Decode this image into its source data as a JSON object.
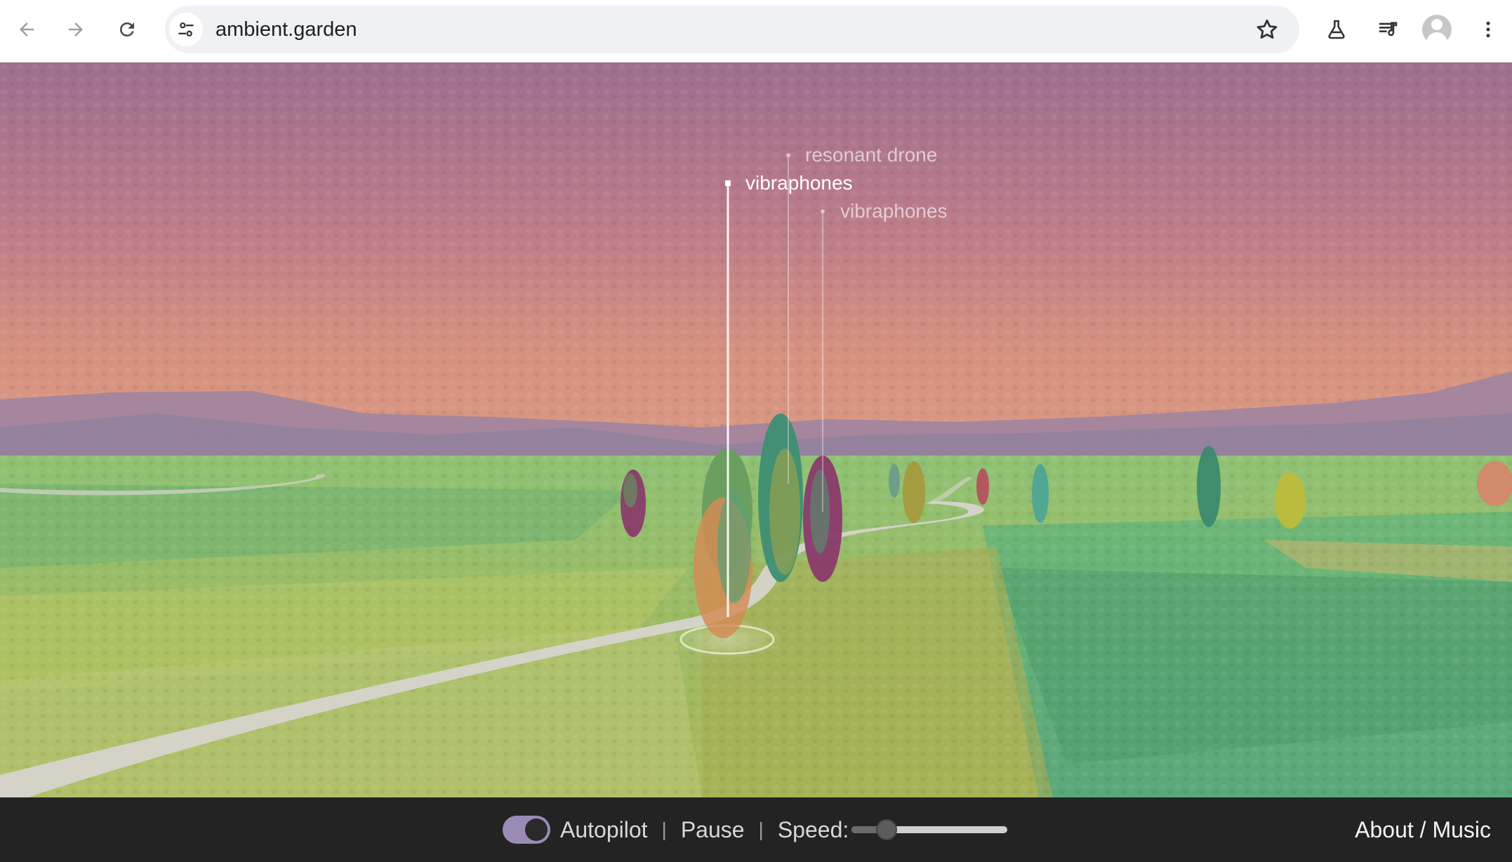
{
  "browser": {
    "url": "ambient.garden",
    "back_icon": "arrow-left-icon",
    "forward_icon": "arrow-right-icon",
    "reload_icon": "reload-icon",
    "site_info_icon": "tune-icon",
    "bookmark_icon": "star-icon",
    "labs_icon": "flask-icon",
    "media_icon": "playlist-music-icon",
    "profile_icon": "avatar-icon",
    "menu_icon": "more-vertical-icon"
  },
  "scene": {
    "labels": [
      {
        "text": "resonant drone",
        "state": "faded"
      },
      {
        "text": "vibraphones",
        "state": "active"
      },
      {
        "text": "vibraphones",
        "state": "faded"
      }
    ],
    "colors": {
      "sky_top": "#a0728e",
      "sky_horizon": "#d99a82",
      "hills": "#9a80a0",
      "grass": "#7fb86a",
      "path": "#d8d6cf"
    }
  },
  "controls": {
    "autopilot_label": "Autopilot",
    "autopilot_on": true,
    "pause_label": "Pause",
    "separator": "|",
    "speed_label": "Speed:",
    "speed_value": 0.18,
    "about_label": "About / Music"
  }
}
